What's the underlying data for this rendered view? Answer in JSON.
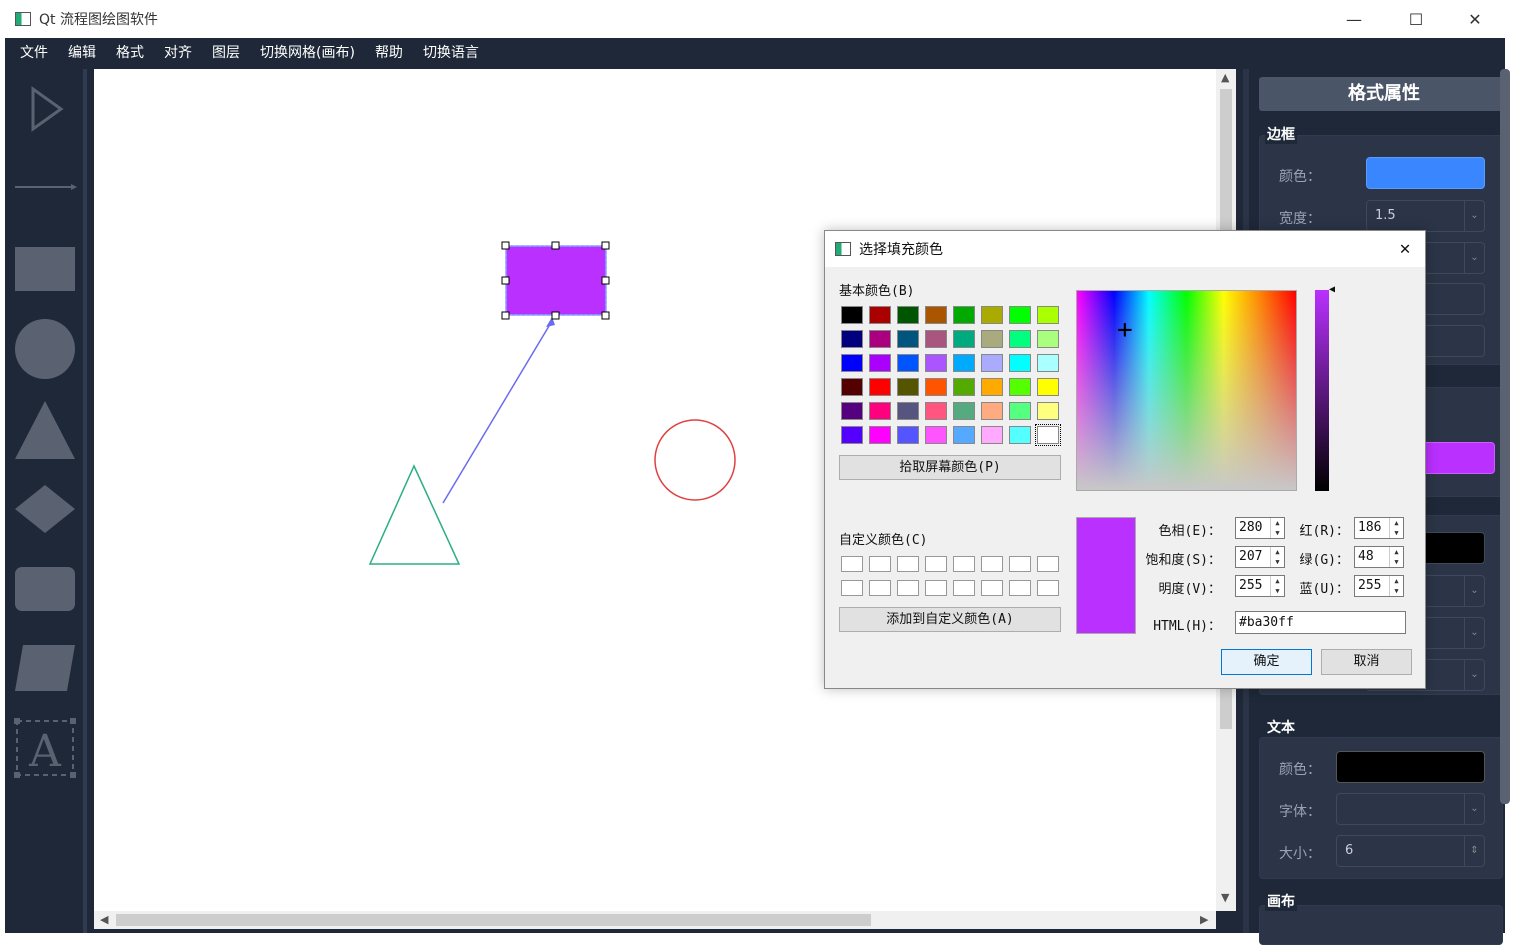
{
  "window": {
    "title": "Qt 流程图绘图软件",
    "controls": [
      "—",
      "☐",
      "✕"
    ]
  },
  "menu": [
    "文件",
    "编辑",
    "格式",
    "对齐",
    "图层",
    "切换网格(画布)",
    "帮助",
    "切换语言"
  ],
  "toolbox": {
    "tools": [
      "pointer-tool",
      "arrow-line-tool",
      "rectangle-tool",
      "circle-tool",
      "triangle-tool",
      "diamond-tool",
      "rounded-rectangle-tool",
      "parallelogram-tool",
      "text-tool"
    ],
    "text_tool_glyph": "A"
  },
  "canvas": {
    "selected_rect_fill": "#ba30ff",
    "arrow_color": "#6b6bf0",
    "triangle_color": "#2bae85",
    "circle_color": "#e04040"
  },
  "panel": {
    "title": "格式属性",
    "border_group": "边框",
    "color_label": "颜色：",
    "border_color": "#3a86ff",
    "width_label": "宽度：",
    "width_value": "1.5",
    "fill_color": "#ba30ff",
    "text_group": "文本",
    "text_color_label": "颜色：",
    "text_color": "#000000",
    "font_label": "字体：",
    "font_value": "",
    "size_label": "大小：",
    "size_value": "6",
    "canvas_group": "画布"
  },
  "dialog": {
    "title": "选择填充颜色",
    "basic_colors_label": "基本颜色(B)",
    "basic_colors": [
      "#000000",
      "#aa0000",
      "#005500",
      "#aa5500",
      "#00aa00",
      "#aaaa00",
      "#00ff00",
      "#aaff00",
      "#00007f",
      "#aa007f",
      "#00557f",
      "#aa557f",
      "#00aa7f",
      "#aaaa7f",
      "#00ff7f",
      "#aaff7f",
      "#0000ff",
      "#aa00ff",
      "#0055ff",
      "#aa55ff",
      "#00aaff",
      "#aaaaff",
      "#00ffff",
      "#aaffff",
      "#550000",
      "#ff0000",
      "#555500",
      "#ff5500",
      "#55aa00",
      "#ffaa00",
      "#55ff00",
      "#ffff00",
      "#55007f",
      "#ff007f",
      "#55557f",
      "#ff557f",
      "#55aa7f",
      "#ffaa7f",
      "#55ff7f",
      "#ffff7f",
      "#5500ff",
      "#ff00ff",
      "#5555ff",
      "#ff55ff",
      "#55aaff",
      "#ffaaff",
      "#55ffff",
      "#ffffff"
    ],
    "pick_screen_button": "拾取屏幕颜色(P)",
    "custom_colors_label": "自定义颜色(C)",
    "add_custom_button": "添加到自定义颜色(A)",
    "hue_label": "色相(E)：",
    "hue_value": "280",
    "sat_label": "饱和度(S)：",
    "sat_value": "207",
    "val_label": "明度(V)：",
    "val_value": "255",
    "red_label": "红(R)：",
    "red_value": "186",
    "green_label": "绿(G)：",
    "green_value": "48",
    "blue_label": "蓝(U)：",
    "blue_value": "255",
    "html_label": "HTML(H)：",
    "html_value": "#ba30ff",
    "preview_color": "#ba30ff",
    "ok_button": "确定",
    "cancel_button": "取消"
  }
}
